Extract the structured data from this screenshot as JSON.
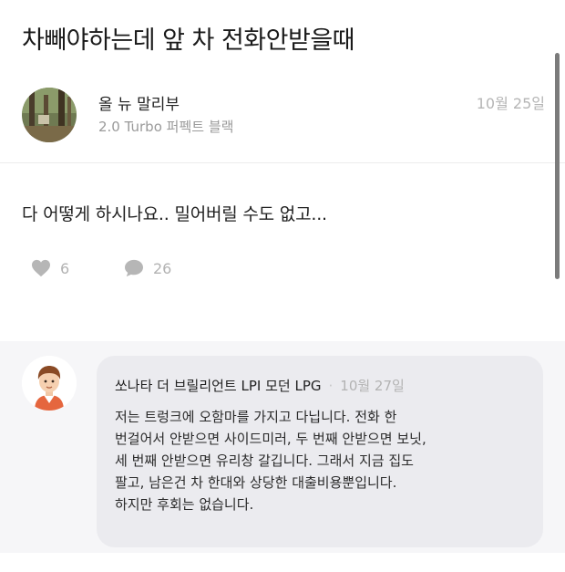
{
  "post": {
    "title": "차빼야하는데 앞 차 전화안받을때",
    "author": "올 뉴 말리부",
    "car": "2.0 Turbo 퍼펙트 블랙",
    "date": "10월 25일",
    "body": "다 어떻게 하시나요.. 밀어버릴 수도 없고...",
    "likes": "6",
    "comments": "26"
  },
  "comment": {
    "author": "쏘나타 더 브릴리언트 LPI 모던 LPG",
    "date": "10월 27일",
    "lines": [
      "저는 트렁크에 오함마를 가지고 다닙니다. 전화 한",
      "번걸어서 안받으면 사이드미러, 두 번째 안받으면 보닛,",
      "세 번째 안받으면 유리창 갈깁니다. 그래서 지금 집도",
      "팔고, 남은건 차 한대와 상당한 대출비용뿐입니다.",
      "하지만 후회는 없습니다."
    ]
  },
  "icons": {
    "like": "heart-icon",
    "comment": "speech-bubble-icon"
  },
  "colors": {
    "muted": "#b2b2b2",
    "comment_bg": "#f6f6f8",
    "bubble_bg": "#ebebef"
  }
}
